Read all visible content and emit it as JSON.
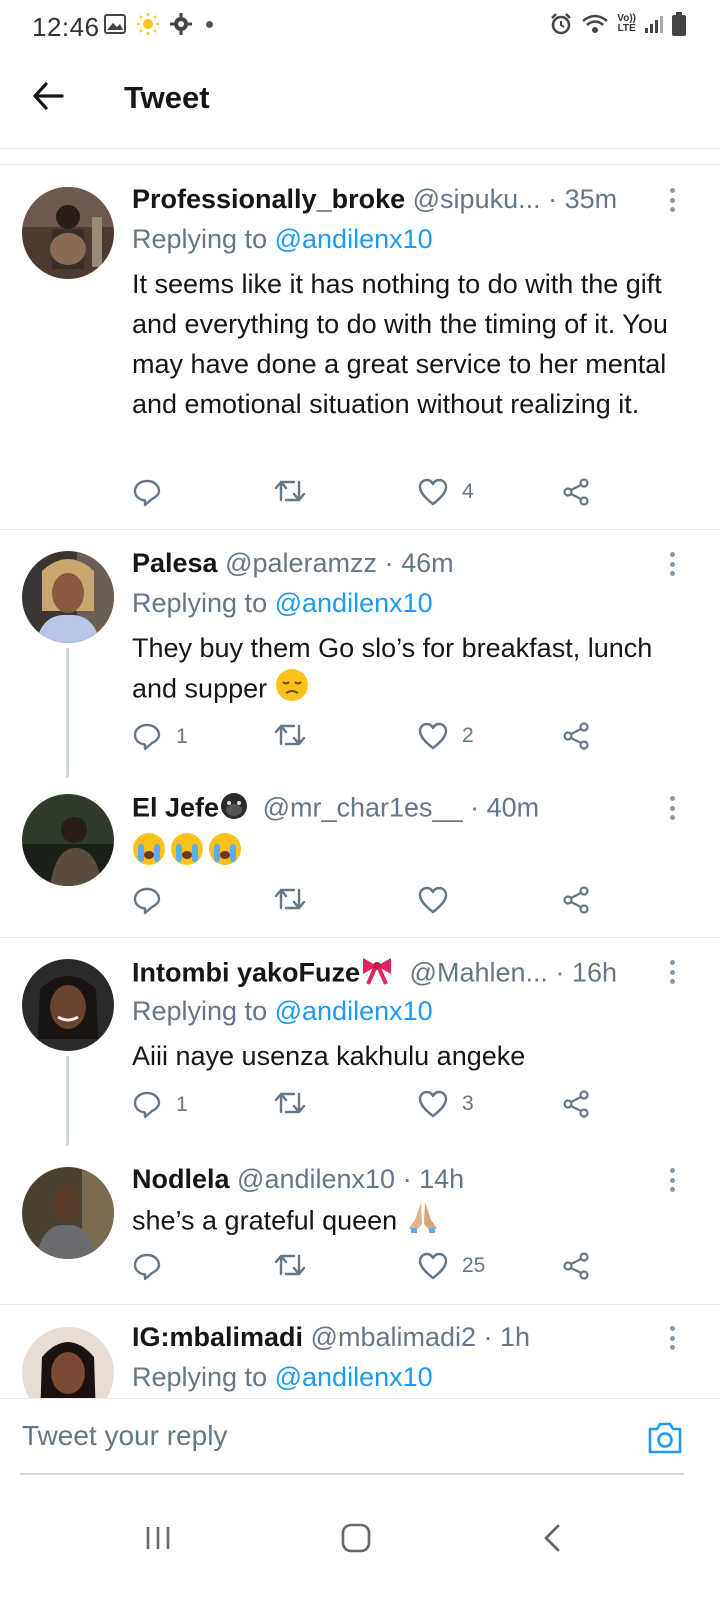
{
  "status_bar": {
    "time": "12:46",
    "left_icons": [
      "image-icon",
      "sun-icon",
      "gear-icon",
      "dot-icon"
    ],
    "right_icons": [
      "alarm-icon",
      "wifi-icon",
      "volte-icon",
      "signal-icon",
      "battery-icon"
    ],
    "volte_label_top": "Vo))",
    "volte_label_bottom": "LTE"
  },
  "header": {
    "title": "Tweet",
    "back_icon": "arrow-left-icon"
  },
  "tweets": [
    {
      "name": "Professionally_broke",
      "handle": "@sipuku...",
      "time": "· 35m",
      "replying_prefix": "Replying to",
      "replying_to": "@andilenx10",
      "text": "It seems like it has nothing to do with the gift and everything to do with the timing of it. You may have done a great service to her mental and emotional situation without realizing it.",
      "reply_count": "",
      "like_count": "4"
    },
    {
      "name": "Palesa",
      "handle": "@paleramzz",
      "time": "· 46m",
      "replying_prefix": "Replying to",
      "replying_to": "@andilenx10",
      "text": "They buy them Go slo’s for breakfast, lunch and supper",
      "emoji": "pensive-face",
      "reply_count": "1",
      "like_count": "2"
    },
    {
      "name": "El Jefe",
      "name_emoji": "gorilla",
      "handle": "@mr_char1es__",
      "time": "· 40m",
      "text_emoji": [
        "loudly-crying-face",
        "loudly-crying-face",
        "loudly-crying-face"
      ],
      "reply_count": "",
      "like_count": ""
    },
    {
      "name": "Intombi yakoFuze",
      "name_emoji": "ribbon",
      "handle": "@Mahlen...",
      "time": "· 16h",
      "replying_prefix": "Replying to",
      "replying_to": "@andilenx10",
      "text": "Aiii naye usenza kakhulu angeke",
      "reply_count": "1",
      "like_count": "3"
    },
    {
      "name": "Nodlela",
      "handle": "@andilenx10",
      "time": "· 14h",
      "text": "she’s a grateful queen",
      "emoji": "folded-hands",
      "reply_count": "",
      "like_count": "25"
    },
    {
      "name": "IG:mbalimadi",
      "handle": "@mbalimadi2",
      "time": "· 1h",
      "replying_prefix": "Replying to",
      "replying_to": "@andilenx10"
    }
  ],
  "reply_bar": {
    "placeholder": "Tweet your reply",
    "camera_icon": "camera-icon"
  },
  "nav_bar": {
    "icons": [
      "recent-apps-icon",
      "home-icon",
      "back-icon"
    ]
  },
  "colors": {
    "accent": "#1d9bf0",
    "secondary_text": "#657786",
    "divider": "#e6ecf0"
  }
}
